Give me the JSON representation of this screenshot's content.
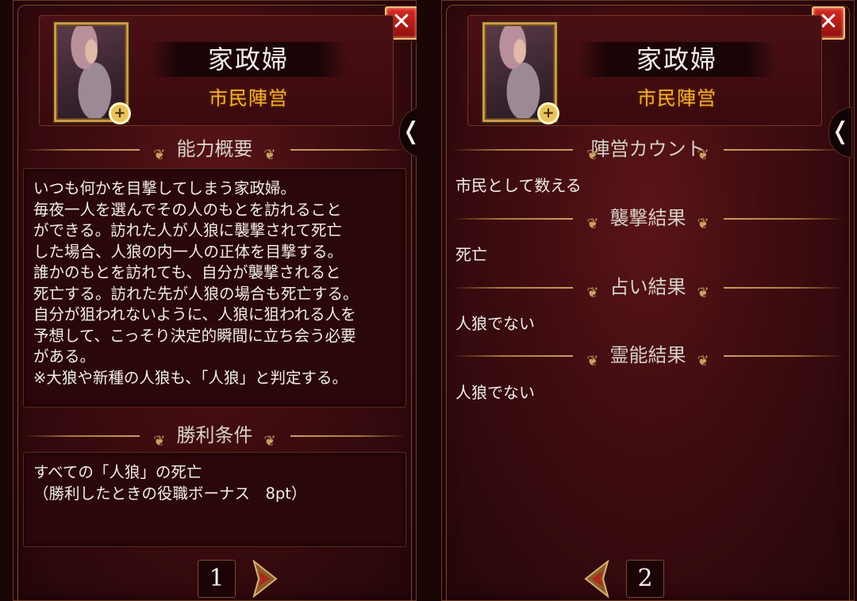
{
  "panels": [
    {
      "close_label": "✕",
      "role_name": "家政婦",
      "faction": "市民陣営",
      "zoom_icon": "+",
      "side_tab_label": "❬",
      "sections": [
        {
          "heading": "能力概要",
          "lines": [
            "いつも何かを目撃してしまう家政婦。",
            "毎夜一人を選んでその人のもとを訪れること",
            "ができる。訪れた人が人狼に襲撃されて死亡",
            "した場合、人狼の内一人の正体を目撃する。",
            "誰かのもとを訪れても、自分が襲撃されると",
            "死亡する。訪れた先が人狼の場合も死亡する。",
            "自分が狙われないように、人狼に狙われる人を",
            "予想して、こっそり決定的瞬間に立ち会う必要",
            "がある。",
            "※大狼や新種の人狼も、「人狼」と判定する。"
          ]
        },
        {
          "heading": "勝利条件",
          "lines": [
            "すべての「人狼」の死亡",
            "（勝利したときの役職ボーナス　8pt）"
          ]
        }
      ],
      "page_number": "1"
    },
    {
      "close_label": "✕",
      "role_name": "家政婦",
      "faction": "市民陣営",
      "zoom_icon": "+",
      "side_tab_label": "❬",
      "sections": [
        {
          "heading": "陣営カウント",
          "text": "市民として数える"
        },
        {
          "heading": "襲撃結果",
          "text": "死亡"
        },
        {
          "heading": "占い結果",
          "text": "人狼でない"
        },
        {
          "heading": "霊能結果",
          "text": "人狼でない"
        }
      ],
      "page_number": "2"
    }
  ],
  "ornament_glyph": "❦",
  "colors": {
    "panel_bg": "#3e0c10",
    "gold_text": "#f0b030",
    "close_red": "#d62b24",
    "border_gold": "#c99a4a"
  },
  "icons": [
    "close-icon",
    "zoom-in-icon",
    "next-page-arrow-icon",
    "prev-page-arrow-icon",
    "collapse-tab-icon"
  ]
}
